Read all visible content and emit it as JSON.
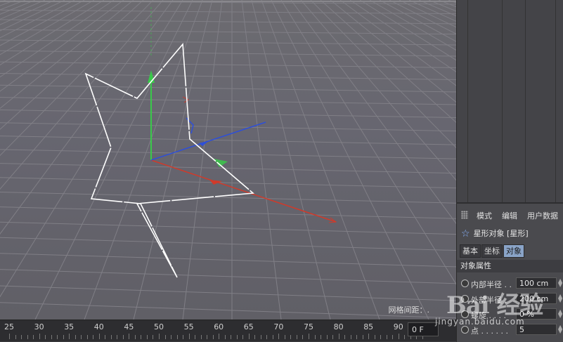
{
  "viewport": {
    "grid_spacing_label": "网格间距：."
  },
  "timeline": {
    "ticks": [
      25,
      30,
      35,
      40,
      45,
      50,
      55,
      60,
      65,
      70,
      75,
      80,
      85,
      90
    ],
    "current_frame": "0 F"
  },
  "attributes": {
    "menu": {
      "mode": "模式",
      "edit": "编辑",
      "user_data": "用户数据"
    },
    "object_title": "星形对象 [星形]",
    "tabs": [
      {
        "label": "基本",
        "active": false
      },
      {
        "label": "坐标",
        "active": false
      },
      {
        "label": "对象",
        "active": true
      }
    ],
    "section": "对象属性",
    "props": [
      {
        "label": "内部半径 . .",
        "value": "100 cm"
      },
      {
        "label": "外部半径 .",
        "value": "200 cm"
      },
      {
        "label": "螺旋 . . . .",
        "value": "0 %"
      },
      {
        "label": "点 . . . . . .",
        "value": "5"
      }
    ]
  },
  "watermark": {
    "logo": "Bai 经验",
    "url": "jingyan.baidu.com"
  },
  "colors": {
    "x_axis": "#d03a2a",
    "y_axis": "#39c94a",
    "z_axis": "#2e4fd8",
    "spline": "#ffffff",
    "active_tab": "#8aa4c8"
  }
}
